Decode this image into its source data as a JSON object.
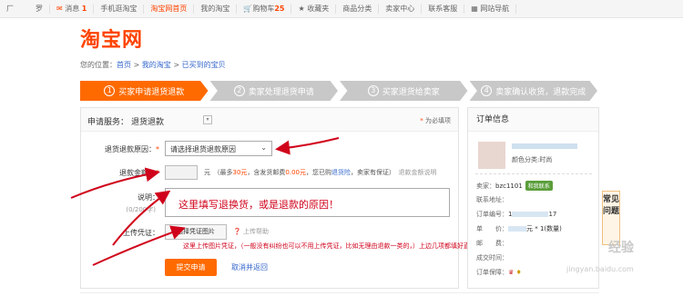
{
  "topbar": {
    "user_initial": "厂",
    "user_suffix": "罗",
    "messages_label": "消息",
    "messages_count": "1",
    "mobile": "手机逛淘宝",
    "home": "淘宝网首页",
    "my_taobao": "我的淘宝",
    "cart_label": "购物车",
    "cart_count": "25",
    "favorites": "收藏夹",
    "categories": "商品分类",
    "seller_center": "卖家中心",
    "contact": "联系客服",
    "site_nav": "网站导航"
  },
  "logo": "淘宝网",
  "breadcrumb": {
    "prefix": "您的位置：",
    "home": "首页",
    "sep1": " > ",
    "my": "我的淘宝",
    "sep2": " > ",
    "bought": "已买到的宝贝"
  },
  "steps": [
    {
      "num": "1",
      "label": "买家申请退货退款"
    },
    {
      "num": "2",
      "label": "卖家处理退货申请"
    },
    {
      "num": "3",
      "label": "买家退货给卖家"
    },
    {
      "num": "4",
      "label": "卖家确认收货，退款完成"
    }
  ],
  "form": {
    "service_label": "申请服务：",
    "service_value": "退货退款",
    "service_arrow": "▾",
    "help": "为必填项",
    "reason_label": "退货退款原因：",
    "reason_placeholder": "请选择退货退款原因",
    "amount_label": "退款金额：",
    "amount_unit": "元",
    "amount_note_a": "（最多",
    "amount_note_b": "30元",
    "amount_note_c": "，含发货邮费",
    "amount_note_d": "0.00元",
    "amount_note_e": "，您已购",
    "amount_note_f": "退货险",
    "amount_note_g": "，卖家有保证）",
    "amount_note_h": "退款金额说明",
    "desc_label": "说明：",
    "desc_text": "这里填写退换货，或是退款的原因！",
    "counter": "(0/200字)",
    "upload_label": "上传凭证：",
    "upload_button": "选择凭证图片",
    "upload_help": "上传帮助",
    "upload_note": "这里上传图片凭证，（一般没有纠纷也可以不用上传凭证，比如无理由退款一类的，）上边几项都填好直接提交就可以啦！",
    "submit": "提交申请",
    "cancel": "取消并返回"
  },
  "order": {
    "title": "订单信息",
    "color_line": "颜色分类:时尚",
    "seller_label": "卖家：",
    "seller_value": "bzc1101",
    "seller_badge": "和我联系",
    "seller_addr_label": "联系地址：",
    "order_no_label": "订单编号：",
    "order_no_value": "1",
    "order_no_tail": "17",
    "price_label": "单　　价：",
    "price_value": "元 * 1(数量)",
    "postage_label": "邮　　费：",
    "time_label": "成交时间：",
    "guarantee_label": "订单保障："
  },
  "faq": "常见问题",
  "watermark": "经验",
  "watermark_url": "jingyan.baidu.com",
  "colors": {
    "accent": "#ff6a00",
    "link": "#3366cc",
    "annotation": "#d0021b",
    "step_inactive": "#c8c8c8"
  }
}
